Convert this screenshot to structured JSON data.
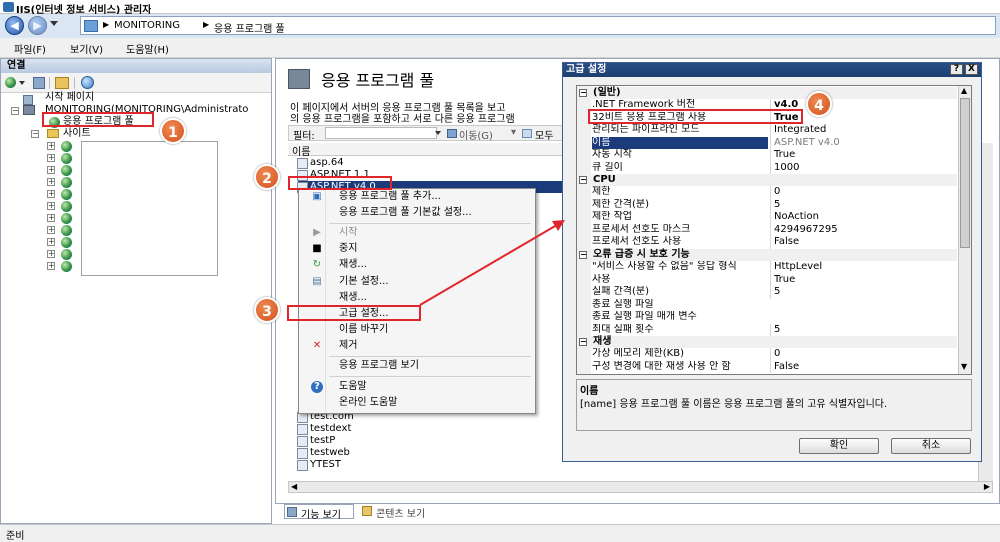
{
  "window": {
    "title": "IIS(인터넷 정보 서비스) 관리자"
  },
  "address": {
    "path": [
      "MONITORING",
      "응용 프로그램 풀"
    ]
  },
  "menu": {
    "items": [
      "파일(F)",
      "보기(V)",
      "도움말(H)"
    ]
  },
  "connections": {
    "header": "연결",
    "start_page": "시작 페이지",
    "server": "MONITORING(MONITORING\\Administrato",
    "app_pools": "응용 프로그램 풀",
    "sites": "사이트"
  },
  "main": {
    "title": "응용 프로그램 풀",
    "description_line1": "이 페이지에서 서버의 응용 프로그램 풀 목록을 보고",
    "description_line2": "의 응용 프로그램을 포함하고 서로 다른 응용 프로그램",
    "filter_label": "필터:",
    "go_label": "이동(G)",
    "show_all_label": "모두",
    "column_name": "이름",
    "pools": [
      "asp.64",
      "ASP.NET 1.1",
      "ASP.NET v4.0"
    ],
    "pools_bottom": [
      "test.com",
      "testdext",
      "testP",
      "testweb",
      "YTEST"
    ]
  },
  "context_menu": {
    "items": [
      {
        "label": "응용 프로그램 풀 추가...",
        "icon": "add-pool-icon",
        "enabled": true
      },
      {
        "label": "응용 프로그램 풀 기본값 설정...",
        "icon": "",
        "enabled": true
      },
      {
        "label": "시작",
        "icon": "play-icon",
        "enabled": false
      },
      {
        "label": "중지",
        "icon": "stop-icon",
        "enabled": true
      },
      {
        "label": "재생...",
        "icon": "recycle-icon",
        "enabled": true
      },
      {
        "label": "기본 설정...",
        "icon": "settings-icon",
        "enabled": true
      },
      {
        "label": "재생...",
        "icon": "",
        "enabled": true
      },
      {
        "label": "고급 설정...",
        "icon": "",
        "enabled": true
      },
      {
        "label": "이름 바꾸기",
        "icon": "",
        "enabled": true
      },
      {
        "label": "제거",
        "icon": "remove-icon",
        "enabled": true
      },
      {
        "label": "응용 프로그램 보기",
        "icon": "",
        "enabled": true
      },
      {
        "label": "도움말",
        "icon": "help-icon",
        "enabled": true
      },
      {
        "label": "온라인 도움말",
        "icon": "",
        "enabled": true
      }
    ]
  },
  "dialog": {
    "title": "고급 설정",
    "help_btn": "?",
    "close_btn": "X",
    "categories": [
      {
        "label": "(일반)",
        "rows": [
          {
            "name": ".NET Framework 버전",
            "value": "v4.0",
            "bold": true
          },
          {
            "name": "32비트 응용 프로그램 사용",
            "value": "True",
            "bold": true
          },
          {
            "name": "관리되는 파이프라인 모드",
            "value": "Integrated"
          },
          {
            "name": "이름",
            "value": "ASP.NET v4.0",
            "selected": true
          },
          {
            "name": "자동 시작",
            "value": "True"
          },
          {
            "name": "큐 길이",
            "value": "1000"
          }
        ]
      },
      {
        "label": "CPU",
        "rows": [
          {
            "name": "제한",
            "value": "0"
          },
          {
            "name": "제한 간격(분)",
            "value": "5"
          },
          {
            "name": "제한 작업",
            "value": "NoAction"
          },
          {
            "name": "프로세서 선호도 마스크",
            "value": "4294967295"
          },
          {
            "name": "프로세서 선호도 사용",
            "value": "False"
          }
        ]
      },
      {
        "label": "오류 급증 시 보호 기능",
        "rows": [
          {
            "name": "\"서비스 사용할 수 없음\" 응답 형식",
            "value": "HttpLevel"
          },
          {
            "name": "사용",
            "value": "True"
          },
          {
            "name": "실패 간격(분)",
            "value": "5"
          },
          {
            "name": "종료 실행 파일",
            "value": ""
          },
          {
            "name": "종료 실행 파일 매개 변수",
            "value": ""
          },
          {
            "name": "최대 실패 횟수",
            "value": "5"
          }
        ]
      },
      {
        "label": "재생",
        "rows": [
          {
            "name": "가상 메모리 제한(KB)",
            "value": "0"
          },
          {
            "name": "구성 변경에 대한 재생 사용 안 함",
            "value": "False"
          }
        ]
      }
    ],
    "desc_title": "이름",
    "desc_text": "[name] 응용 프로그램 풀 이름은 응용 프로그램 풀의 고유 식별자입니다.",
    "ok": "확인",
    "cancel": "취소"
  },
  "view_tabs": {
    "features": "기능 보기",
    "content": "콘텐츠 보기"
  },
  "status": {
    "text": "준비"
  },
  "badges": [
    "1",
    "2",
    "3",
    "4"
  ],
  "colors": {
    "annotation": "#e0262c",
    "badge": "#d9581f",
    "selection": "#1b3b7a",
    "title_bar": "#1d3f72"
  }
}
